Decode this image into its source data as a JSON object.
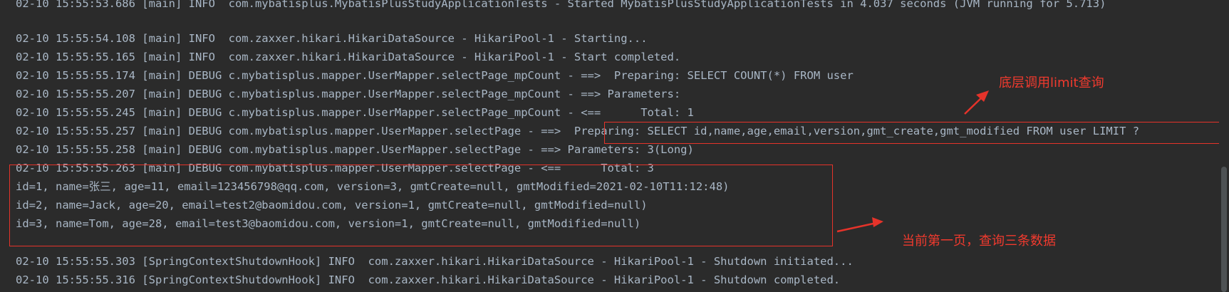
{
  "console": {
    "lines": [
      "02-10 15:55:53.686 [main] INFO  com.mybatisplus.MybatisPlusStudyApplicationTests - Started MybatisPlusStudyApplicationTests in 4.037 seconds (JVM running for 5.713)",
      "",
      "02-10 15:55:54.108 [main] INFO  com.zaxxer.hikari.HikariDataSource - HikariPool-1 - Starting...",
      "02-10 15:55:55.165 [main] INFO  com.zaxxer.hikari.HikariDataSource - HikariPool-1 - Start completed.",
      "02-10 15:55:55.174 [main] DEBUG c.mybatisplus.mapper.UserMapper.selectPage_mpCount - ==>  Preparing: SELECT COUNT(*) FROM user",
      "02-10 15:55:55.207 [main] DEBUG c.mybatisplus.mapper.UserMapper.selectPage_mpCount - ==> Parameters: ",
      "02-10 15:55:55.245 [main] DEBUG c.mybatisplus.mapper.UserMapper.selectPage_mpCount - <==      Total: 1",
      "02-10 15:55:55.257 [main] DEBUG com.mybatisplus.mapper.UserMapper.selectPage - ==>  Preparing: SELECT id,name,age,email,version,gmt_create,gmt_modified FROM user LIMIT ?",
      "02-10 15:55:55.258 [main] DEBUG com.mybatisplus.mapper.UserMapper.selectPage - ==> Parameters: 3(Long)",
      "02-10 15:55:55.263 [main] DEBUG com.mybatisplus.mapper.UserMapper.selectPage - <==      Total: 3",
      "id=1, name=张三, age=11, email=123456798@qq.com, version=3, gmtCreate=null, gmtModified=2021-02-10T11:12:48)",
      "id=2, name=Jack, age=20, email=test2@baomidou.com, version=1, gmtCreate=null, gmtModified=null)",
      "id=3, name=Tom, age=28, email=test3@baomidou.com, version=1, gmtCreate=null, gmtModified=null)",
      "",
      "02-10 15:55:55.303 [SpringContextShutdownHook] INFO  com.zaxxer.hikari.HikariDataSource - HikariPool-1 - Shutdown initiated...",
      "02-10 15:55:55.316 [SpringContextShutdownHook] INFO  com.zaxxer.hikari.HikariDataSource - HikariPool-1 - Shutdown completed."
    ]
  },
  "annotations": {
    "limit_note": "底层调用limit查询",
    "page_note": "当前第一页，查询三条数据"
  },
  "colors": {
    "background": "#2b2b2b",
    "text": "#a9b7c6",
    "annotation": "#e5332a"
  }
}
